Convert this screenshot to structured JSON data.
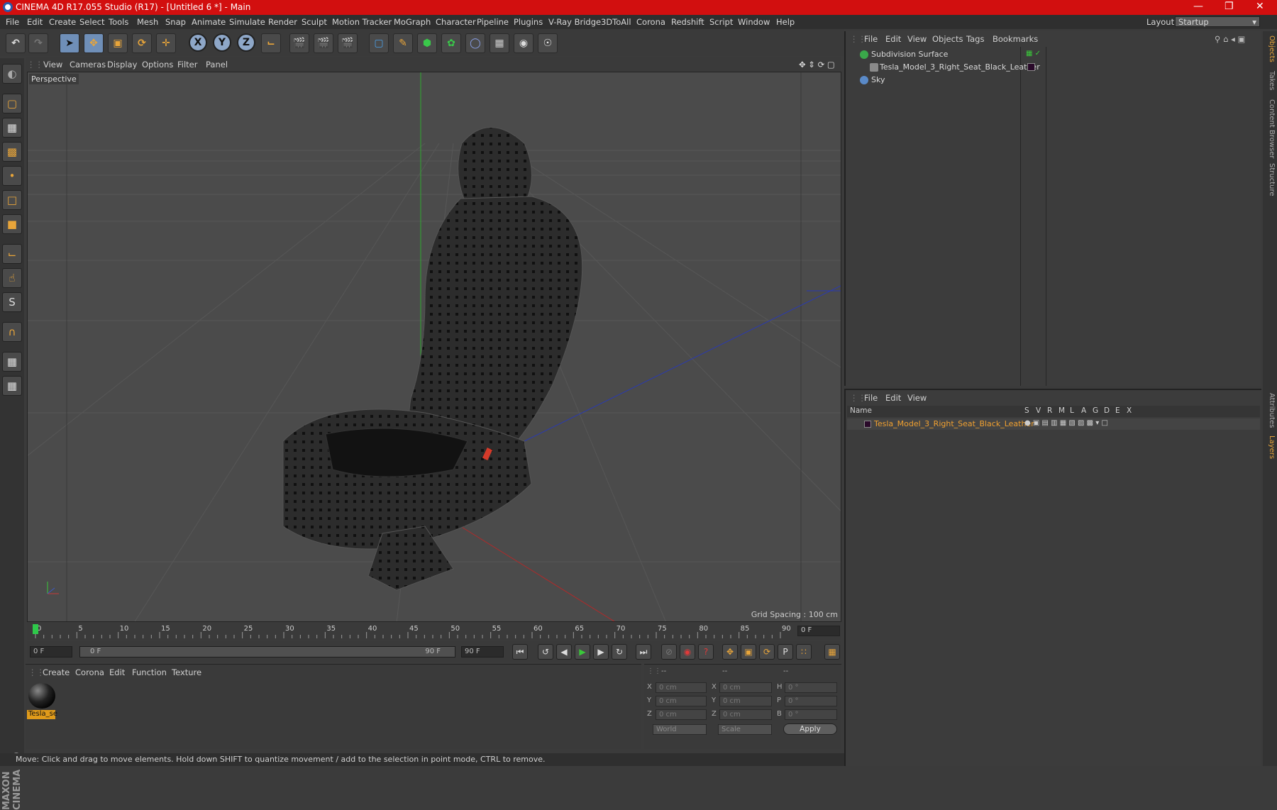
{
  "window": {
    "title": "CINEMA 4D R17.055 Studio (R17) - [Untitled 6 *] - Main"
  },
  "menubar": {
    "items": [
      "File",
      "Edit",
      "Create",
      "Select",
      "Tools",
      "Mesh",
      "Snap",
      "Animate",
      "Simulate",
      "Render",
      "Sculpt",
      "Motion Tracker",
      "MoGraph",
      "Character",
      "Pipeline",
      "Plugins",
      "V-Ray Bridge",
      "3DToAll",
      "Corona",
      "Redshift",
      "Script",
      "Window",
      "Help"
    ],
    "layout_label": "Layout:",
    "layout_value": "Startup"
  },
  "viewport": {
    "menu": [
      "View",
      "Cameras",
      "Display",
      "Options",
      "Filter",
      "Panel"
    ],
    "label": "Perspective",
    "grid_spacing": "Grid Spacing : 100 cm"
  },
  "timeline": {
    "ticks": [
      "0",
      "5",
      "10",
      "15",
      "20",
      "25",
      "30",
      "35",
      "40",
      "45",
      "50",
      "55",
      "60",
      "65",
      "70",
      "75",
      "80",
      "85",
      "90"
    ],
    "current_frame": "0 F",
    "start_field": "0 F",
    "range_start": "0 F",
    "range_end": "90 F",
    "end_field": "90 F"
  },
  "materials": {
    "menu": [
      "Create",
      "Corona",
      "Edit",
      "Function",
      "Texture"
    ],
    "items": [
      {
        "label": "Tesla_se"
      }
    ]
  },
  "coordinates": {
    "headers": [
      "--",
      "--",
      "--"
    ],
    "rows": [
      {
        "a": "X",
        "v1": "0 cm",
        "b": "X",
        "v2": "0 cm",
        "c": "H",
        "v3": "0 °"
      },
      {
        "a": "Y",
        "v1": "0 cm",
        "b": "Y",
        "v2": "0 cm",
        "c": "P",
        "v3": "0 °"
      },
      {
        "a": "Z",
        "v1": "0 cm",
        "b": "Z",
        "v2": "0 cm",
        "c": "B",
        "v3": "0 °"
      }
    ],
    "mode1": "World",
    "mode2": "Scale",
    "apply": "Apply"
  },
  "objects_panel": {
    "menu": [
      "File",
      "Edit",
      "View",
      "Objects",
      "Tags",
      "Bookmarks"
    ],
    "objects": [
      {
        "name": "Subdivision Surface",
        "icon_color": "#3aa84a"
      },
      {
        "name": "Tesla_Model_3_Right_Seat_Black_Leather",
        "icon_color": "#8a8a8a"
      },
      {
        "name": "Sky",
        "icon_color": "#5a8ac8"
      }
    ]
  },
  "layers_panel": {
    "menu": [
      "File",
      "Edit",
      "View"
    ],
    "columns": [
      "Name",
      "S",
      "V",
      "R",
      "M",
      "L",
      "A",
      "G",
      "D",
      "E",
      "X"
    ],
    "layer_name": "Tesla_Model_3_Right_Seat_Black_Leather"
  },
  "right_tabs": [
    "Objects",
    "Takes",
    "Content Browser",
    "Structure",
    "Attributes",
    "Layers"
  ],
  "brand": "MAXON CINEMA 4D",
  "status": "Move: Click and drag to move elements. Hold down SHIFT to quantize movement / add to the selection in point mode, CTRL to remove.",
  "colors": {
    "titlebar": "#d20f0f",
    "accent": "#e8a53a",
    "layer_name": "#f0a030"
  }
}
